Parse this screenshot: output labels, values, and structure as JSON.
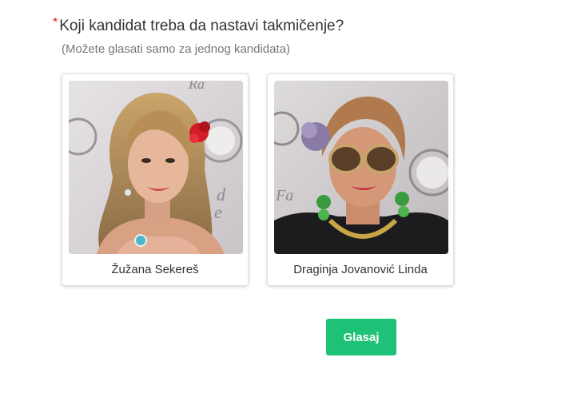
{
  "question": {
    "required_marker": "*",
    "text": "Koji kandidat treba da nastavi takmičenje?",
    "hint": "(Možete glasati samo za jednog kandidata)"
  },
  "candidates": [
    {
      "name": "Žužana Sekereš",
      "photo": "blonde-woman-with-red-flower-photo"
    },
    {
      "name": "Draginja Jovanović Linda",
      "photo": "woman-with-sunglasses-and-flower-photo"
    }
  ],
  "vote_button": {
    "label": "Glasaj"
  },
  "colors": {
    "accent": "#1ec276",
    "required": "#e02020",
    "text": "#333333",
    "hint": "#777777"
  }
}
